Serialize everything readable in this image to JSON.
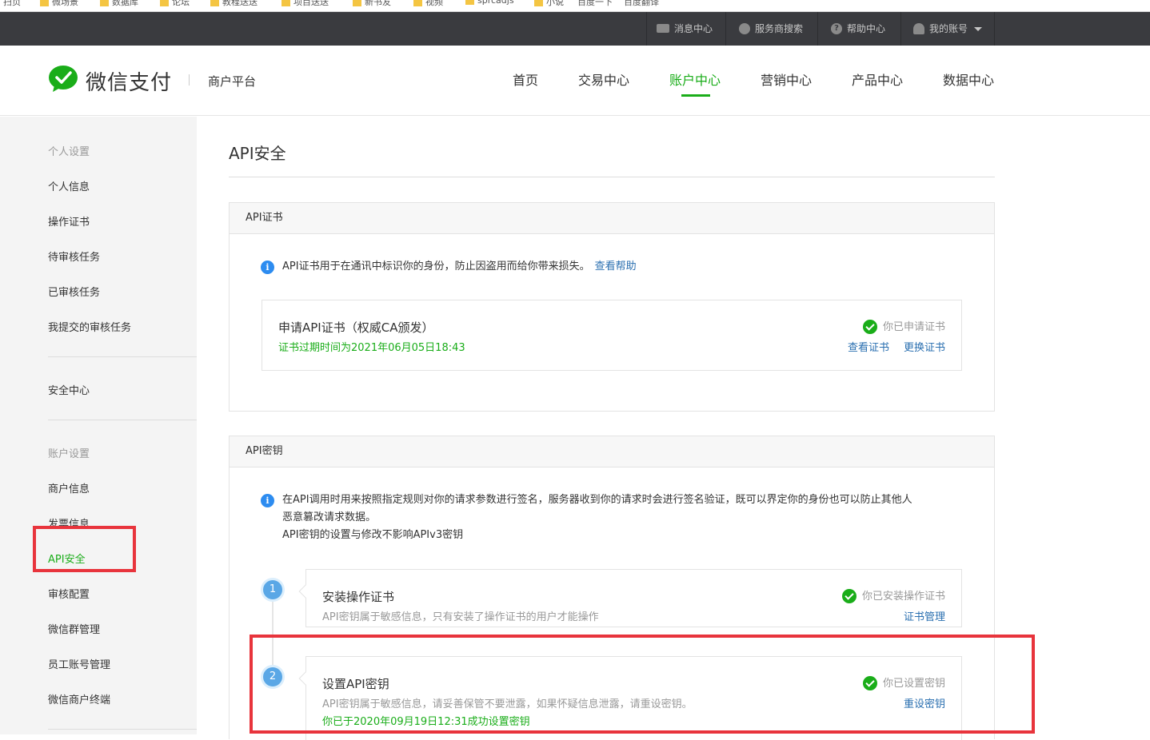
{
  "bookmarks": [
    "扫页",
    "微场景",
    "数据库",
    "论坛",
    "教程送送",
    "项目送送",
    "新书友",
    "视频",
    "sprcadjs",
    "小说",
    "百度一下",
    "百度翻译"
  ],
  "topbar": {
    "items": [
      {
        "label": "消息中心",
        "icon": "envelope-icon"
      },
      {
        "label": "服务商搜索",
        "icon": "search-icon"
      },
      {
        "label": "帮助中心",
        "icon": "question-icon"
      },
      {
        "label": "我的账号",
        "icon": "user-icon"
      }
    ]
  },
  "header": {
    "logo_text": "微信支付",
    "logo_sub": "商户平台",
    "nav": [
      "首页",
      "交易中心",
      "账户中心",
      "营销中心",
      "产品中心",
      "数据中心"
    ],
    "active_nav": "账户中心"
  },
  "sidebar": {
    "personal_head": "个人设置",
    "personal_items": [
      "个人信息",
      "操作证书",
      "待审核任务",
      "已审核任务",
      "我提交的审核任务"
    ],
    "security": "安全中心",
    "account_head": "账户设置",
    "account_items": [
      "商户信息",
      "发票信息",
      "API安全",
      "审核配置",
      "微信群管理",
      "员工账号管理",
      "微信商户终端"
    ],
    "active_item": "API安全"
  },
  "main": {
    "title": "API安全",
    "cert_panel": {
      "head": "API证书",
      "info": "API证书用于在通讯中标识你的身份，防止因盗用而给你带来损失。",
      "help_link": "查看帮助",
      "card_title": "申请API证书（权威CA颁发）",
      "card_sub": "证书过期时间为2021年06月05日18:43",
      "status": "你已申请证书",
      "action_view": "查看证书",
      "action_replace": "更换证书"
    },
    "key_panel": {
      "head": "API密钥",
      "info_line1": "在API调用时用来按照指定规则对你的请求参数进行签名，服务器收到你的请求时会进行签名验证，既可以界定你的身份也可以防止其他人",
      "info_line2": "恶意篡改请求数据。",
      "info_line3": "API密钥的设置与修改不影响APIv3密钥",
      "step1": {
        "num": "1",
        "title": "安装操作证书",
        "sub": "API密钥属于敏感信息，只有安装了操作证书的用户才能操作",
        "status": "你已安装操作证书",
        "action": "证书管理"
      },
      "step2": {
        "num": "2",
        "title": "设置API密钥",
        "sub": "API密钥属于敏感信息，请妥善保管不要泄露，如果怀疑信息泄露，请重设密钥。",
        "note": "你已于2020年09月19日12:31成功设置密钥",
        "status": "你已设置密钥",
        "action": "重设密钥"
      }
    }
  },
  "colors": {
    "accent": "#1aad19",
    "link": "#2a6fb0",
    "highlight": "#e8343c",
    "topbar": "#3a3b3f"
  }
}
